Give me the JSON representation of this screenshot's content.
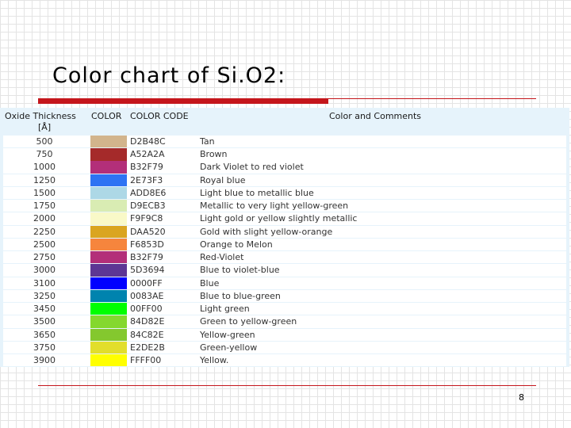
{
  "slide": {
    "title": "Color chart of Si.O2:",
    "page_number": "8"
  },
  "table": {
    "headers": {
      "thickness_line1": "Oxide Thickness",
      "thickness_line2": "[Å]",
      "color": "COLOR",
      "code": "COLOR CODE",
      "comments": "Color and Comments"
    },
    "rows": [
      {
        "thickness": "500",
        "code": "D2B48C",
        "swatch": "#D2B48C",
        "comment": "Tan"
      },
      {
        "thickness": "750",
        "code": "A52A2A",
        "swatch": "#A52A2A",
        "comment": "Brown"
      },
      {
        "thickness": "1000",
        "code": "B32F79",
        "swatch": "#B32F79",
        "comment": "Dark Violet to red violet"
      },
      {
        "thickness": "1250",
        "code": "2E73F3",
        "swatch": "#2E73F3",
        "comment": "Royal blue"
      },
      {
        "thickness": "1500",
        "code": "ADD8E6",
        "swatch": "#ADD8E6",
        "comment": "Light blue to metallic blue"
      },
      {
        "thickness": "1750",
        "code": "D9ECB3",
        "swatch": "#D9ECB3",
        "comment": "Metallic to very light yellow-green"
      },
      {
        "thickness": "2000",
        "code": "F9F9C8",
        "swatch": "#F9F9C8",
        "comment": "Light gold or yellow slightly metallic"
      },
      {
        "thickness": "2250",
        "code": "DAA520",
        "swatch": "#DAA520",
        "comment": "Gold with slight yellow-orange"
      },
      {
        "thickness": "2500",
        "code": "F6853D",
        "swatch": "#F6853D",
        "comment": "Orange to Melon"
      },
      {
        "thickness": "2750",
        "code": "B32F79",
        "swatch": "#B32F79",
        "comment": "Red-Violet"
      },
      {
        "thickness": "3000",
        "code": "5D3694",
        "swatch": "#5D3694",
        "comment": "Blue to violet-blue"
      },
      {
        "thickness": "3100",
        "code": "0000FF",
        "swatch": "#0000FF",
        "comment": "Blue"
      },
      {
        "thickness": "3250",
        "code": "0083AE",
        "swatch": "#0083AE",
        "comment": "Blue to blue-green"
      },
      {
        "thickness": "3450",
        "code": "00FF00",
        "swatch": "#00FF00",
        "comment": "Light green"
      },
      {
        "thickness": "3500",
        "code": "84D82E",
        "swatch": "#84D82E",
        "comment": "Green to yellow-green"
      },
      {
        "thickness": "3650",
        "code": "84C82E",
        "swatch": "#84C82E",
        "comment": "Yellow-green"
      },
      {
        "thickness": "3750",
        "code": "E2DE2B",
        "swatch": "#E2DE2B",
        "comment": "Green-yellow"
      },
      {
        "thickness": "3900",
        "code": "FFFF00",
        "swatch": "#FFFF00",
        "comment": "Yellow."
      }
    ]
  }
}
